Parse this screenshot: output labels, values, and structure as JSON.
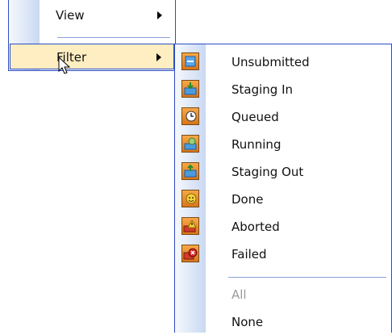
{
  "main_menu": {
    "items": [
      {
        "label": "View"
      },
      {
        "label": "Filter"
      }
    ]
  },
  "filter_submenu": {
    "items": [
      {
        "label": "Unsubmitted",
        "icon": "unsubmitted-icon"
      },
      {
        "label": "Staging In",
        "icon": "staging-in-icon"
      },
      {
        "label": "Queued",
        "icon": "queued-clock-icon"
      },
      {
        "label": "Running",
        "icon": "running-gear-icon"
      },
      {
        "label": "Staging Out",
        "icon": "staging-out-icon"
      },
      {
        "label": "Done",
        "icon": "done-smiley-icon"
      },
      {
        "label": "Aborted",
        "icon": "aborted-warning-icon"
      },
      {
        "label": "Failed",
        "icon": "failed-x-icon"
      },
      {
        "label": "All",
        "disabled": true
      },
      {
        "label": "None"
      }
    ]
  },
  "colors": {
    "menu_border": "#2c4dc2",
    "highlight": "#ffeec2",
    "icon_orange": "#f0962e",
    "disabled_text": "#9a9a9a"
  }
}
